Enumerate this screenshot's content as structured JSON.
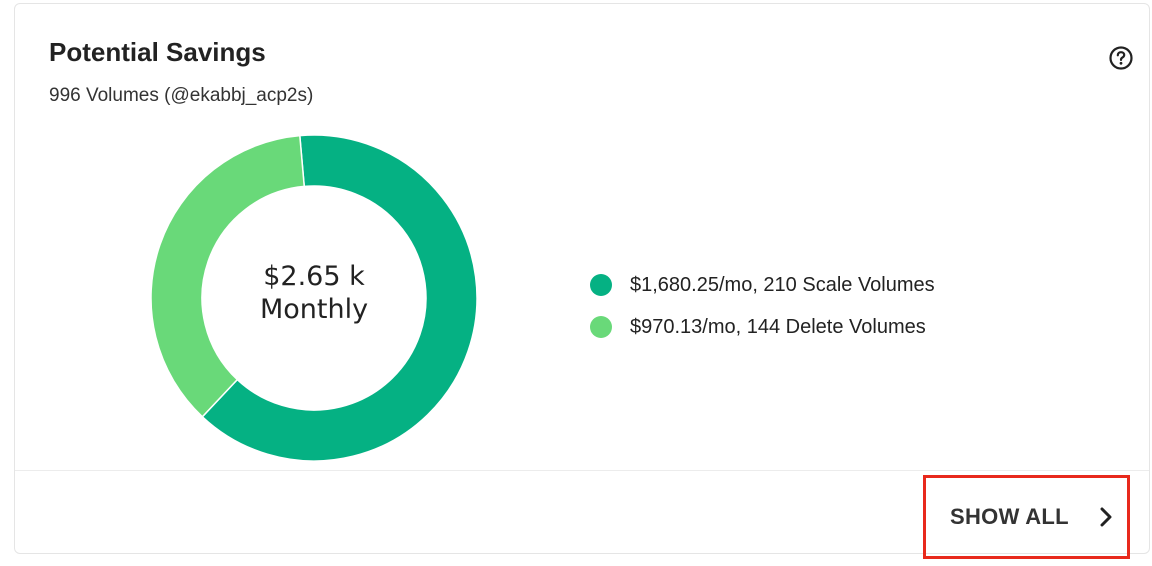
{
  "card": {
    "title": "Potential Savings",
    "subtitle": "996 Volumes (@ekabbj_acp2s)",
    "help_icon": "question-circle-icon"
  },
  "chart_data": {
    "type": "pie",
    "center_label_line1": "$2.65 k",
    "center_label_line2": "Monthly",
    "series": [
      {
        "label": "$1,680.25/mo, 210 Scale Volumes",
        "value": 1680.25,
        "color": "#05b183"
      },
      {
        "label": "$970.13/mo, 144 Delete Volumes",
        "value": 970.13,
        "color": "#69d979"
      }
    ]
  },
  "footer": {
    "show_all_label": "SHOW ALL",
    "chevron_icon": "chevron-right-icon",
    "highlight_color": "#e8291c"
  }
}
